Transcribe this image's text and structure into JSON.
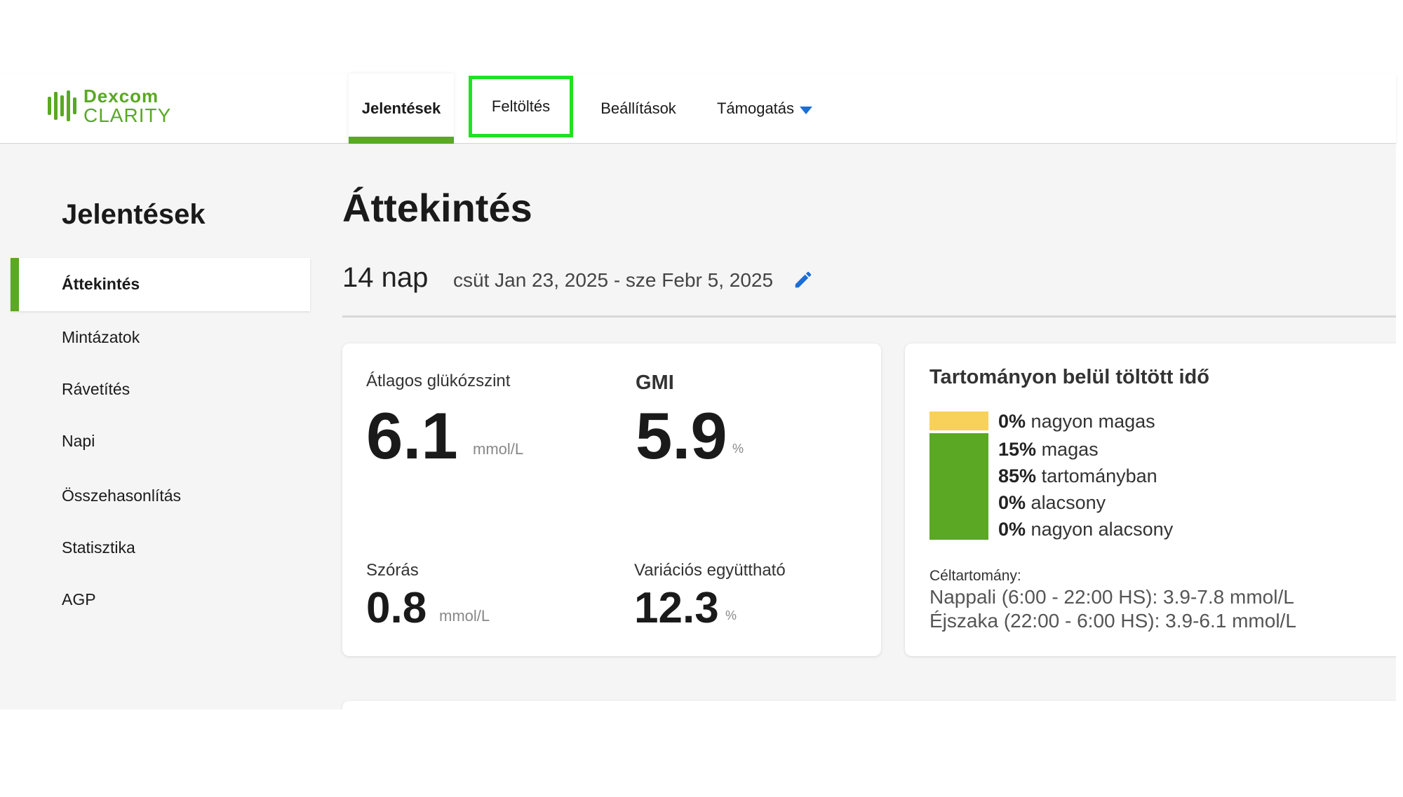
{
  "header": {
    "logo_top": "Dexcom",
    "logo_bottom": "CLARITY",
    "tabs": [
      {
        "label": "Jelentések"
      },
      {
        "label": "Feltöltés"
      },
      {
        "label": "Beállítások"
      },
      {
        "label": "Támogatás"
      }
    ],
    "accent_color": "#5aa823",
    "highlight_color": "#22e022"
  },
  "sidebar": {
    "title": "Jelentések",
    "items": [
      {
        "label": "Áttekintés"
      },
      {
        "label": "Mintázatok"
      },
      {
        "label": "Rávetítés"
      },
      {
        "label": "Napi"
      },
      {
        "label": "Összehasonlítás"
      },
      {
        "label": "Statisztika"
      },
      {
        "label": "AGP"
      }
    ]
  },
  "main": {
    "title": "Áttekintés",
    "range_days": "14 nap",
    "range_dates": "csüt Jan 23, 2025 - sze Febr 5, 2025",
    "edit_icon": "pencil-icon"
  },
  "stats": {
    "avg_label": "Átlagos glükózszint",
    "avg_value": "6.1",
    "avg_unit": "mmol/L",
    "gmi_label": "GMI",
    "gmi_value": "5.9",
    "gmi_unit": "%",
    "sd_label": "Szórás",
    "sd_value": "0.8",
    "sd_unit": "mmol/L",
    "cv_label": "Variációs együttható",
    "cv_value": "12.3",
    "cv_unit": "%"
  },
  "tir": {
    "title": "Tartományon belül töltött idő",
    "rows": [
      {
        "pct": "0%",
        "label": "nagyon magas",
        "value": 0,
        "color": "#f8d15a"
      },
      {
        "pct": "15%",
        "label": "magas",
        "value": 15,
        "color": "#f8d15a"
      },
      {
        "pct": "85%",
        "label": "tartományban",
        "value": 85,
        "color": "#5aa823"
      },
      {
        "pct": "0%",
        "label": "alacsony",
        "value": 0,
        "color": "#e23b3b"
      },
      {
        "pct": "0%",
        "label": "nagyon alacsony",
        "value": 0,
        "color": "#a81e1e"
      }
    ],
    "target_label": "Céltartomány:",
    "target_day": "Nappali (6:00 - 22:00 HS): 3.9-7.8 mmol/L",
    "target_night": "Éjszaka (22:00 - 6:00 HS): 3.9-6.1 mmol/L"
  }
}
